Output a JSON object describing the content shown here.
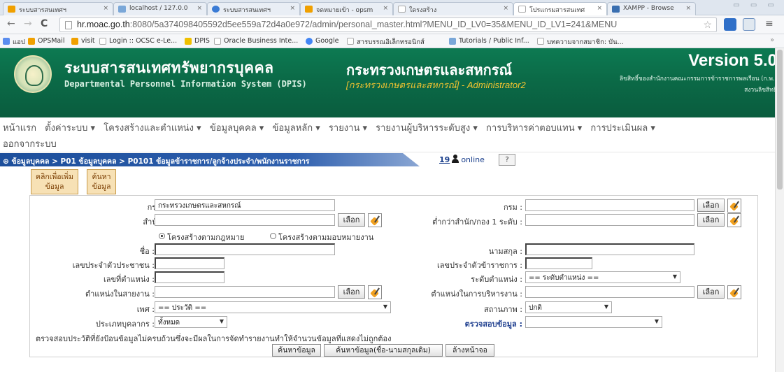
{
  "browser": {
    "tabs": [
      {
        "label": "ระบบสารสนเทศฯ",
        "color": "#f0a000"
      },
      {
        "label": "localhost / 127.0.0",
        "color": "#7aa7d8"
      },
      {
        "label": "ระบบสารสนเทศฯ",
        "color": "#3a7bd5"
      },
      {
        "label": "จดหมายเข้า - opsm",
        "color": "#f0a000"
      },
      {
        "label": "ใดรงสร้าง",
        "color": "#cccccc"
      },
      {
        "label": "โปรแกรมสารสนเทศ",
        "color": "#cccccc"
      },
      {
        "label": "XAMPP - Browse",
        "color": "#3a6fb0"
      }
    ],
    "url_host": "hr.moac.go.th",
    "url_rest": ":8080/5a374098405592d5ee559a72d4a0e972/admin/personal_master.html?MENU_ID_LV0=35&MENU_ID_LV1=241&MENU",
    "bookmarks": [
      {
        "label": "แอป",
        "color": "#5b8def"
      },
      {
        "label": "OPSMail",
        "color": "#f0a000"
      },
      {
        "label": "visit",
        "color": "#f0a000"
      },
      {
        "label": "Login :: OCSC e-Le...",
        "color": "#cccccc"
      },
      {
        "label": "DPIS",
        "color": "#f0c000"
      },
      {
        "label": "Oracle Business Inte...",
        "color": "#cccccc"
      },
      {
        "label": "Google",
        "color": "#4285f4"
      },
      {
        "label": "สารบรรณอิเล็กทรอนิกส์",
        "color": "#cccccc"
      },
      {
        "label": "Tutorials / Public Inf...",
        "color": "#7aa7d8"
      },
      {
        "label": "บทความจากสมาชิก: บัน...",
        "color": "#cccccc"
      }
    ],
    "bookmarks_more": "»"
  },
  "header": {
    "title_th": "ระบบสารสนเทศทรัพยากรบุคคล",
    "title_en": "Departmental Personnel Information System (DPIS)",
    "ministry": "กระทรวงเกษตรและสหกรณ์",
    "ministry_sub": "[กระทรวงเกษตรและสหกรณ์] - Administrator2",
    "version": "Version 5.0",
    "copyright_line1": "ลิขสิทธิ์ของสำนักงานคณะกรรมการข้าราชการพลเรือน (ก.พ.)",
    "copyright_line2": "สงวนลิขสิทธิ์"
  },
  "menu": {
    "row1": [
      "หน้าแรก",
      "ตั้งค่าระบบ ▾",
      "โครงสร้างและตำแหน่ง ▾",
      "ข้อมูลบุคคล ▾",
      "ข้อมูลหลัก ▾",
      "รายงาน ▾",
      "รายงานผู้บริหารระดับสูง ▾",
      "การบริหารค่าตอบแทน ▾",
      "การประเมินผล ▾"
    ],
    "row2": [
      "ออกจากระบบ"
    ]
  },
  "breadcrumb": "⊕ ข้อมูลบุคคล > P01 ข้อมูลบุคคล > P0101 ข้อมูลข้าราชการ/ลูกจ้างประจำ/พนักงานราชการ",
  "online": {
    "count": "19",
    "label": "online",
    "help": "?"
  },
  "action_tabs": {
    "add_line1": "คลิกเพื่อเพิ่ม",
    "add_line2": "ข้อมูล",
    "search_line1": "ค้นหา",
    "search_line2": "ข้อมูล"
  },
  "form": {
    "ministry_label": "กระทรวง :",
    "ministry_value": "กระทรวงเกษตรและสหกรณ์",
    "department_label": "กรม :",
    "department_value": "",
    "office_label": "สำนัก/กอง :",
    "office_value": "",
    "sub_office_label": "ต่ำกว่าสำนัก/กอง 1 ระดับ :",
    "sub_office_value": "",
    "pick_label": "เลือก",
    "radio_structure_law": "โครงสร้างตามกฎหมาย",
    "radio_structure_assign": "โครงสร้างตามมอบหมายงาน",
    "name_label": "ชื่อ :",
    "surname_label": "นามสกุล :",
    "citizen_id_label": "เลขประจำตัวประชาชน :",
    "civil_id_label": "เลขประจำตัวข้าราชการ :",
    "position_no_label": "เลขที่ตำแหน่ง :",
    "position_level_label": "ระดับตำแหน่ง :",
    "position_level_value": "== ระดับตำแหน่ง ==",
    "line_position_label": "ตำแหน่งในสายงาน :",
    "admin_position_label": "ตำแหน่งในการบริหารงาน :",
    "gender_label": "เพศ :",
    "gender_value": "== ประวัติ ==",
    "status_label": "สถานภาพ :",
    "status_value": "ปกติ",
    "person_type_label": "ประเภทบุคลากร :",
    "person_type_value": "ทั้งหมด",
    "check_label": "ตรวจสอบข้อมูล :",
    "check_value": "",
    "note": "ตรวจสอบประวัติที่ยังป้อนข้อมูลไม่ครบถ้วนซึ่งจะมีผลในการจัดทำรายงานทำให้จำนวนข้อมูลที่แสดงไม่ถูกต้อง",
    "btn_search": "ค้นหาข้อมูล",
    "btn_search_old": "ค้นหาข้อมูล(ชื่อ-นามสกุลเดิม)",
    "btn_clear": "ล้างหน้าจอ"
  }
}
